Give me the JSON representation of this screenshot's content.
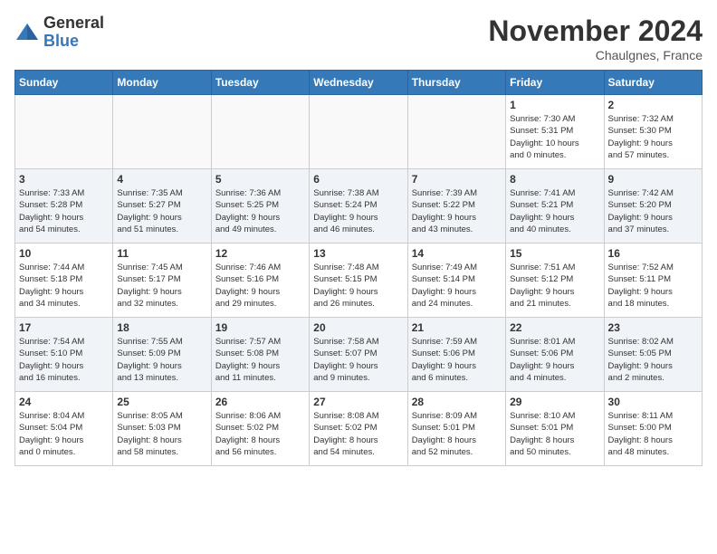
{
  "logo": {
    "general": "General",
    "blue": "Blue"
  },
  "header": {
    "month": "November 2024",
    "location": "Chaulgnes, France"
  },
  "weekdays": [
    "Sunday",
    "Monday",
    "Tuesday",
    "Wednesday",
    "Thursday",
    "Friday",
    "Saturday"
  ],
  "weeks": [
    [
      {
        "day": "",
        "text": ""
      },
      {
        "day": "",
        "text": ""
      },
      {
        "day": "",
        "text": ""
      },
      {
        "day": "",
        "text": ""
      },
      {
        "day": "",
        "text": ""
      },
      {
        "day": "1",
        "text": "Sunrise: 7:30 AM\nSunset: 5:31 PM\nDaylight: 10 hours\nand 0 minutes."
      },
      {
        "day": "2",
        "text": "Sunrise: 7:32 AM\nSunset: 5:30 PM\nDaylight: 9 hours\nand 57 minutes."
      }
    ],
    [
      {
        "day": "3",
        "text": "Sunrise: 7:33 AM\nSunset: 5:28 PM\nDaylight: 9 hours\nand 54 minutes."
      },
      {
        "day": "4",
        "text": "Sunrise: 7:35 AM\nSunset: 5:27 PM\nDaylight: 9 hours\nand 51 minutes."
      },
      {
        "day": "5",
        "text": "Sunrise: 7:36 AM\nSunset: 5:25 PM\nDaylight: 9 hours\nand 49 minutes."
      },
      {
        "day": "6",
        "text": "Sunrise: 7:38 AM\nSunset: 5:24 PM\nDaylight: 9 hours\nand 46 minutes."
      },
      {
        "day": "7",
        "text": "Sunrise: 7:39 AM\nSunset: 5:22 PM\nDaylight: 9 hours\nand 43 minutes."
      },
      {
        "day": "8",
        "text": "Sunrise: 7:41 AM\nSunset: 5:21 PM\nDaylight: 9 hours\nand 40 minutes."
      },
      {
        "day": "9",
        "text": "Sunrise: 7:42 AM\nSunset: 5:20 PM\nDaylight: 9 hours\nand 37 minutes."
      }
    ],
    [
      {
        "day": "10",
        "text": "Sunrise: 7:44 AM\nSunset: 5:18 PM\nDaylight: 9 hours\nand 34 minutes."
      },
      {
        "day": "11",
        "text": "Sunrise: 7:45 AM\nSunset: 5:17 PM\nDaylight: 9 hours\nand 32 minutes."
      },
      {
        "day": "12",
        "text": "Sunrise: 7:46 AM\nSunset: 5:16 PM\nDaylight: 9 hours\nand 29 minutes."
      },
      {
        "day": "13",
        "text": "Sunrise: 7:48 AM\nSunset: 5:15 PM\nDaylight: 9 hours\nand 26 minutes."
      },
      {
        "day": "14",
        "text": "Sunrise: 7:49 AM\nSunset: 5:14 PM\nDaylight: 9 hours\nand 24 minutes."
      },
      {
        "day": "15",
        "text": "Sunrise: 7:51 AM\nSunset: 5:12 PM\nDaylight: 9 hours\nand 21 minutes."
      },
      {
        "day": "16",
        "text": "Sunrise: 7:52 AM\nSunset: 5:11 PM\nDaylight: 9 hours\nand 18 minutes."
      }
    ],
    [
      {
        "day": "17",
        "text": "Sunrise: 7:54 AM\nSunset: 5:10 PM\nDaylight: 9 hours\nand 16 minutes."
      },
      {
        "day": "18",
        "text": "Sunrise: 7:55 AM\nSunset: 5:09 PM\nDaylight: 9 hours\nand 13 minutes."
      },
      {
        "day": "19",
        "text": "Sunrise: 7:57 AM\nSunset: 5:08 PM\nDaylight: 9 hours\nand 11 minutes."
      },
      {
        "day": "20",
        "text": "Sunrise: 7:58 AM\nSunset: 5:07 PM\nDaylight: 9 hours\nand 9 minutes."
      },
      {
        "day": "21",
        "text": "Sunrise: 7:59 AM\nSunset: 5:06 PM\nDaylight: 9 hours\nand 6 minutes."
      },
      {
        "day": "22",
        "text": "Sunrise: 8:01 AM\nSunset: 5:06 PM\nDaylight: 9 hours\nand 4 minutes."
      },
      {
        "day": "23",
        "text": "Sunrise: 8:02 AM\nSunset: 5:05 PM\nDaylight: 9 hours\nand 2 minutes."
      }
    ],
    [
      {
        "day": "24",
        "text": "Sunrise: 8:04 AM\nSunset: 5:04 PM\nDaylight: 9 hours\nand 0 minutes."
      },
      {
        "day": "25",
        "text": "Sunrise: 8:05 AM\nSunset: 5:03 PM\nDaylight: 8 hours\nand 58 minutes."
      },
      {
        "day": "26",
        "text": "Sunrise: 8:06 AM\nSunset: 5:02 PM\nDaylight: 8 hours\nand 56 minutes."
      },
      {
        "day": "27",
        "text": "Sunrise: 8:08 AM\nSunset: 5:02 PM\nDaylight: 8 hours\nand 54 minutes."
      },
      {
        "day": "28",
        "text": "Sunrise: 8:09 AM\nSunset: 5:01 PM\nDaylight: 8 hours\nand 52 minutes."
      },
      {
        "day": "29",
        "text": "Sunrise: 8:10 AM\nSunset: 5:01 PM\nDaylight: 8 hours\nand 50 minutes."
      },
      {
        "day": "30",
        "text": "Sunrise: 8:11 AM\nSunset: 5:00 PM\nDaylight: 8 hours\nand 48 minutes."
      }
    ]
  ]
}
